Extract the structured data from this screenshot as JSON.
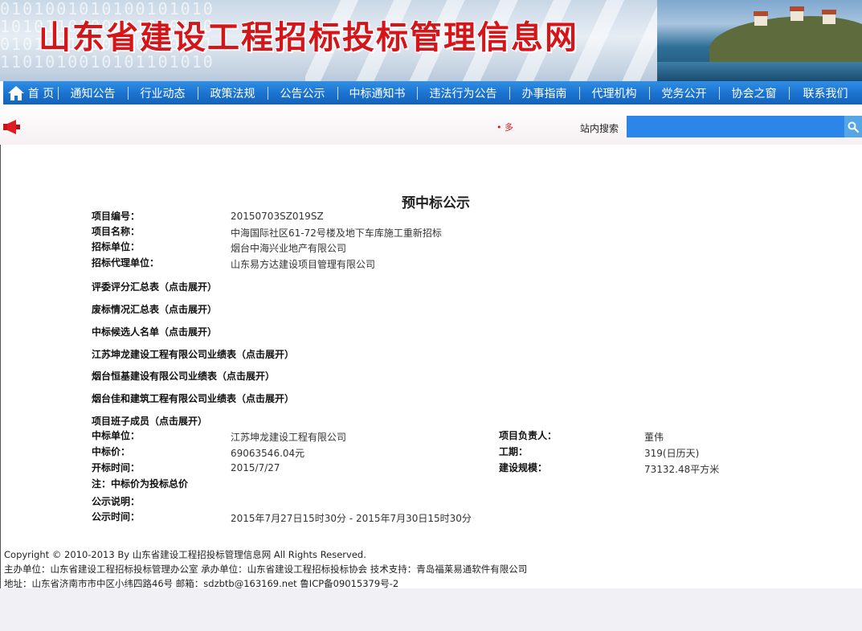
{
  "banner": {
    "title": "山东省建设工程招标投标管理信息网",
    "binary_text": "0101001010100101010\n1010110100101010110\n0101101010010110101\n1101010010101101010"
  },
  "nav": {
    "items": [
      {
        "label": "首 页"
      },
      {
        "label": "通知公告"
      },
      {
        "label": "行业动态"
      },
      {
        "label": "政策法规"
      },
      {
        "label": "公告公示"
      },
      {
        "label": "中标通知书"
      },
      {
        "label": "违法行为公告"
      },
      {
        "label": "办事指南"
      },
      {
        "label": "代理机构"
      },
      {
        "label": "党务公开"
      },
      {
        "label": "协会之窗"
      },
      {
        "label": "联系我们"
      }
    ]
  },
  "subbar": {
    "marquee": "• 多",
    "search_label": "站内搜索",
    "search_value": ""
  },
  "announcement": {
    "title": "预中标公示",
    "project_no_label": "项目编号：",
    "project_no": "20150703SZ019SZ",
    "project_name_label": "项目名称：",
    "project_name": "中海国际社区61-72号楼及地下车库施工重新招标",
    "tenderer_label": "招标单位：",
    "tenderer": "烟台中海兴业地产有限公司",
    "agent_label": "招标代理单位：",
    "agent": "山东易方达建设项目管理有限公司",
    "sections": [
      "评委评分汇总表（点击展开）",
      "废标情况汇总表（点击展开）",
      "中标候选人名单（点击展开）",
      "江苏坤龙建设工程有限公司业绩表（点击展开）",
      "烟台恒基建设有限公司业绩表（点击展开）",
      "烟台佳和建筑工程有限公司业绩表（点击展开）",
      "项目班子成员（点击展开）"
    ],
    "winner_label": "中标单位：",
    "winner": "江苏坤龙建设工程有限公司",
    "manager_label": "项目负责人：",
    "manager": "董伟",
    "price_label": "中标价：",
    "price": "69063546.04元",
    "duration_label": "工期：",
    "duration": "319(日历天)",
    "open_time_label": "开标时间：",
    "open_time": "2015/7/27",
    "scale_label": "建设规模：",
    "scale": "73132.48平方米",
    "note": "注：中标价为投标总价",
    "remark_label": "公示说明：",
    "remark": "",
    "period_label": "公示时间：",
    "period": "2015年7月27日15时30分 - 2015年7月30日15时30分"
  },
  "footer": {
    "copyright": "Copyright © 2010-2013 By 山东省建设工程招投标管理信息网  All Rights Reserved.",
    "sponsor": "主办单位：山东省建设工程招标投标管理办公室  承办单位：山东省建设工程招标投标协会  技术支持：青岛福莱易通软件有限公司",
    "address": "地址：山东省济南市市中区小纬四路46号   邮箱：sdzbtb@163169.net   鲁ICP备09015379号-2"
  },
  "colors": {
    "nav_blue": "#1a72cf",
    "title_red": "#d4161a",
    "search_blue": "#2c86ea"
  }
}
